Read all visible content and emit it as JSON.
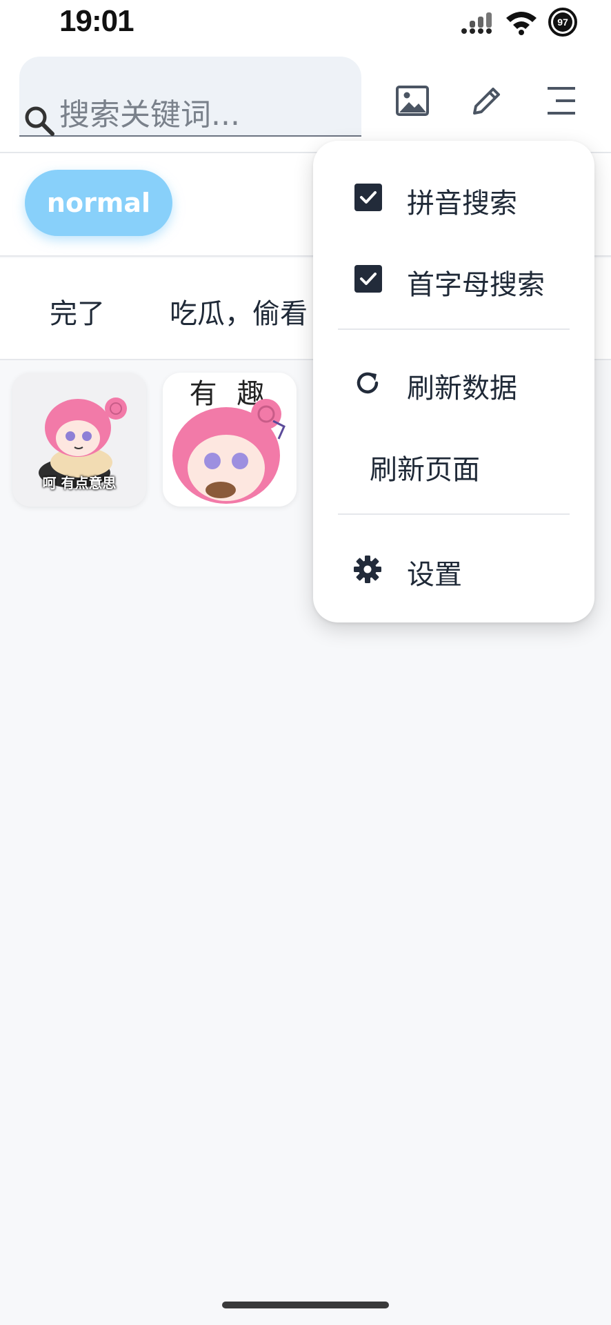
{
  "status_bar": {
    "time": "19:01",
    "battery": "97",
    "icons": [
      "signal-icon",
      "wifi-icon",
      "battery-icon"
    ]
  },
  "search": {
    "placeholder": "搜索关键词..."
  },
  "toolbar": {
    "icons": [
      "image-icon",
      "pencil-icon",
      "menu-icon"
    ]
  },
  "categories": [
    {
      "label": "normal",
      "selected": true
    }
  ],
  "tags": [
    {
      "label": "完了"
    },
    {
      "label": "吃瓜，偷看"
    }
  ],
  "stickers": [
    {
      "caption": "呵 有点意思"
    },
    {
      "caption": "有 趣"
    }
  ],
  "menu": {
    "items": [
      {
        "label": "拼音搜索",
        "type": "checkbox",
        "checked": true
      },
      {
        "label": "首字母搜索",
        "type": "checkbox",
        "checked": true
      },
      {
        "label": "刷新数据",
        "type": "action",
        "icon": "refresh-icon"
      },
      {
        "label": "刷新页面",
        "type": "action"
      },
      {
        "label": "设置",
        "type": "action",
        "icon": "gear-icon"
      }
    ]
  },
  "colors": {
    "chip_bg": "#88d0fa",
    "checkbox": "#222b3a",
    "page_bg": "#f7f8fa"
  }
}
